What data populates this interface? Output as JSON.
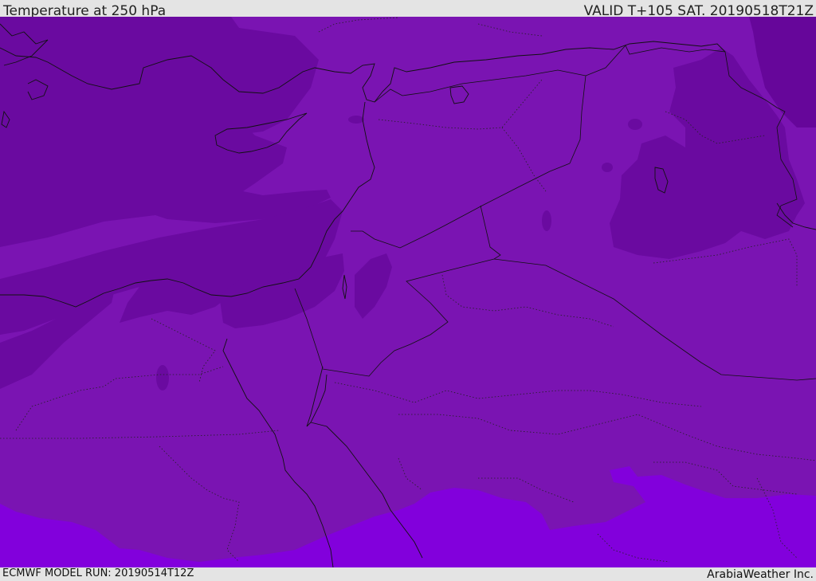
{
  "header": {
    "title": "Temperature at 250 hPa",
    "valid": "VALID T+105 SAT. 20190518T21Z"
  },
  "footer": {
    "model_run": "ECMWF MODEL RUN: 20190514T12Z",
    "credit": "ArabiaWeather Inc."
  },
  "map": {
    "colors": {
      "base": "#7a14b2",
      "cold": "#6a0aa0",
      "colder": "#66069a",
      "warm": "#8200dc",
      "lines": "#111111"
    }
  }
}
